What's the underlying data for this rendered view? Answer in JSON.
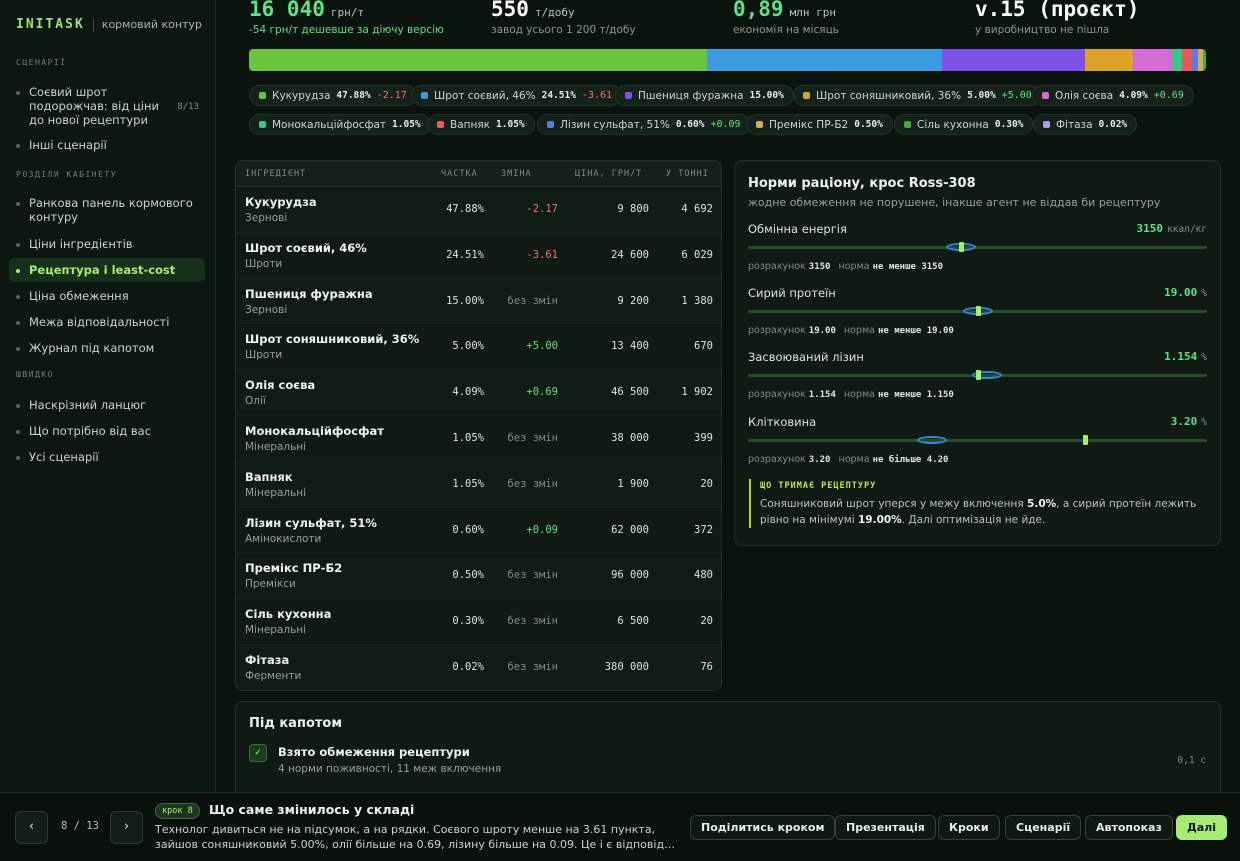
{
  "brand": {
    "logo": "INITASK",
    "subtitle": "кормовий контур"
  },
  "sidebar": {
    "sections": [
      {
        "title": "СЦЕНАРІЇ",
        "items": [
          {
            "label": "Соєвий шрот подорожчав: від ціни до нової рецептури",
            "count": "8/13",
            "active": false
          },
          {
            "label": "Інші сценарії",
            "active": false
          }
        ]
      },
      {
        "title": "РОЗДІЛИ КАБІНЕТУ",
        "items": [
          {
            "label": "Ранкова панель кормового контуру",
            "active": false
          },
          {
            "label": "Ціни інгредієнтів",
            "active": false
          },
          {
            "label": "Рецептура і least-cost",
            "active": true
          },
          {
            "label": "Ціна обмеження",
            "active": false
          },
          {
            "label": "Межа відповідальності",
            "active": false
          },
          {
            "label": "Журнал під капотом",
            "active": false
          }
        ]
      },
      {
        "title": "ШВИДКО",
        "items": [
          {
            "label": "Наскрізний ланцюг",
            "active": false
          },
          {
            "label": "Що потрібно від вас",
            "active": false
          },
          {
            "label": "Усі сценарії",
            "active": false
          }
        ]
      }
    ]
  },
  "stats": [
    {
      "value": "16 040",
      "unit": "грн/т",
      "note": "-54 грн/т дешевше за діючу версію",
      "color": "#5fe08a",
      "note_color": "#5fe08a"
    },
    {
      "value": "550",
      "unit": "т/добу",
      "note": "завод усього 1 200 т/добу",
      "color": "#ffffff",
      "note_color": "#8a998f"
    },
    {
      "value": "0,89",
      "unit": "млн грн",
      "note": "економія на місяць",
      "color": "#5fe08a",
      "note_color": "#8a998f"
    },
    {
      "value": "v.15 (проєкт)",
      "unit": "",
      "note": "у виробництво не пішла",
      "color": "#ffffff",
      "note_color": "#8a998f"
    }
  ],
  "ingredients": [
    {
      "name": "Кукурудза",
      "chip_name": "Кукурудза",
      "category": "Зернові",
      "share": "47.88%",
      "share_num": 47.88,
      "change": "-2.17",
      "change_type": "neg",
      "price": "9 800",
      "per_ton": "4 692",
      "color": "#6cc43a"
    },
    {
      "name": "Шрот соєвий, 46%",
      "chip_name": "Шрот соєвий, 46%",
      "category": "Шроти",
      "share": "24.51%",
      "share_num": 24.51,
      "change": "-3.61",
      "change_type": "neg",
      "price": "24 600",
      "per_ton": "6 029",
      "color": "#3a9be0"
    },
    {
      "name": "Пшениця фуражна",
      "chip_name": "Пшениця фуражна",
      "category": "Зернові",
      "share": "15.00%",
      "share_num": 15.0,
      "change": "без змін",
      "change_type": "none",
      "price": "9 200",
      "per_ton": "1 380",
      "color": "#7b52e8"
    },
    {
      "name": "Шрот соняшниковий, 36%",
      "chip_name": "Шрот соняшниковий, 36%",
      "category": "Шроти",
      "share": "5.00%",
      "share_num": 5.0,
      "change": "+5.00",
      "change_type": "pos",
      "price": "13 400",
      "per_ton": "670",
      "color": "#dca12a"
    },
    {
      "name": "Олія соєва",
      "chip_name": "Олія соєва",
      "category": "Олії",
      "share": "4.09%",
      "share_num": 4.09,
      "change": "+0.69",
      "change_type": "pos",
      "price": "46 500",
      "per_ton": "1 902",
      "color": "#d36ad6"
    },
    {
      "name": "Монокальційфосфат",
      "chip_name": "Монокальційфосфат",
      "category": "Мінеральні",
      "share": "1.05%",
      "share_num": 1.05,
      "change": "без змін",
      "change_type": "none",
      "price": "38 000",
      "per_ton": "399",
      "color": "#3cc48a"
    },
    {
      "name": "Вапняк",
      "chip_name": "Вапняк",
      "category": "Мінеральні",
      "share": "1.05%",
      "share_num": 1.05,
      "change": "без змін",
      "change_type": "none",
      "price": "1 900",
      "per_ton": "20",
      "color": "#e25a5a"
    },
    {
      "name": "Лізин сульфат, 51%",
      "chip_name": "Лізин сульфат, 51%",
      "category": "Амінокислоти",
      "share": "0.60%",
      "share_num": 0.6,
      "change": "+0.09",
      "change_type": "pos",
      "price": "62 000",
      "per_ton": "372",
      "color": "#5a7ae0"
    },
    {
      "name": "Премікс ПР-Б2",
      "chip_name": "Премікс ПР-Б2",
      "category": "Премікси",
      "share": "0.50%",
      "share_num": 0.5,
      "change": "без змін",
      "change_type": "none",
      "price": "96 000",
      "per_ton": "480",
      "color": "#d9a860"
    },
    {
      "name": "Сіль кухонна",
      "chip_name": "Сіль кухонна",
      "category": "Мінеральні",
      "share": "0.30%",
      "share_num": 0.3,
      "change": "без змін",
      "change_type": "none",
      "price": "6 500",
      "per_ton": "20",
      "color": "#3fae3a"
    },
    {
      "name": "Фітаза",
      "chip_name": "Фітаза",
      "category": "Ферменти",
      "share": "0.02%",
      "share_num": 0.02,
      "change": "без змін",
      "change_type": "none",
      "price": "380 000",
      "per_ton": "76",
      "color": "#a99ae8"
    }
  ],
  "table": {
    "headers": [
      "ІНГРЕДІЄНТ",
      "ЧАСТКА",
      "ЗМІНА",
      "ЦІНА, ГРН/Т",
      "У ТОННІ"
    ]
  },
  "norms": {
    "title": "Норми раціону, крос Ross-308",
    "subtitle": "жодне обмеження не порушене, інакше агент не віддав би рецептуру",
    "calc_label": "розрахунок",
    "norm_label": "норма",
    "items": [
      {
        "label": "Обмінна енергія",
        "value": "3150",
        "unit": "ккал/кг",
        "calc": "3150",
        "norm": "не менше 3150",
        "level": 0.465,
        "ring_level": 0.465
      },
      {
        "label": "Сирий протеїн",
        "value": "19.00",
        "unit": "%",
        "calc": "19.00",
        "norm": "не менше 19.00",
        "level": 0.5,
        "ring_level": 0.5
      },
      {
        "label": "Засвоюваний лізин",
        "value": "1.154",
        "unit": "%",
        "calc": "1.154",
        "norm": "не менше 1.150",
        "level": 0.5,
        "ring_level": 0.52
      },
      {
        "label": "Клітковина",
        "value": "3.20",
        "unit": "%",
        "calc": "3.20",
        "norm": "не більше 4.20",
        "level": 0.735,
        "ring_level": 0.4
      }
    ],
    "holds_title": "ЩО ТРИМАЄ РЕЦЕПТУРУ",
    "holds_text_1": "Соняшниковий шрот уперся у межу включення ",
    "holds_bold_1": "5.0%",
    "holds_text_2": ", а сирий протеїн лежить рівно на мінімумі ",
    "holds_bold_2": "19.00%",
    "holds_text_3": ". Далі оптимізація не йде."
  },
  "hood": {
    "title": "Під капотом",
    "check": "✓",
    "step_name": "Взято обмеження рецептури",
    "step_desc": "4 норми поживності, 11 меж включення",
    "time": "0,1 с"
  },
  "bottom": {
    "prev": "‹",
    "next": "›",
    "pager": "8 / 13",
    "step_tag": "крок 8",
    "step_title": "Що саме змінилось у складі",
    "step_line1": "Технолог дивиться не на підсумок, а на рядки. Соєвого шроту менше на 3.61 пункта,",
    "step_line2": "зайшов соняшниковий 5.00%, олії більше на 0.69, лізину більше на 0.09. Це і є відповідь ...",
    "buttons": [
      "Поділитись кроком",
      "Презентація",
      "Кроки",
      "Сценарії",
      "Автопоказ",
      "Далі"
    ]
  },
  "colors": {
    "positive": "#5fe08a",
    "negative": "#f07070",
    "neutral": "#7d8d82",
    "accent": "#a6ec72"
  }
}
